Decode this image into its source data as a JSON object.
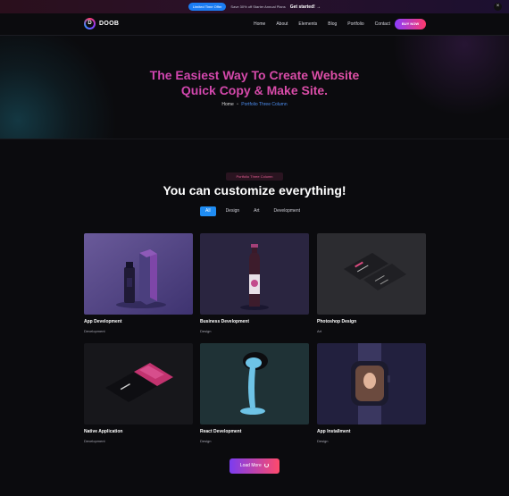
{
  "announcement": {
    "badge": "Limited Time Offer",
    "text": "Save 30% off Starter Annual Plans",
    "link": "Get started! →",
    "close": "×"
  },
  "header": {
    "logo_mark": "D",
    "logo_text": "DOOB",
    "nav": [
      "Home",
      "About",
      "Elements",
      "Blog",
      "Portfolio",
      "Contact"
    ],
    "cta": "BUY NOW"
  },
  "hero": {
    "title_line1": "The Easiest Way To Create Website",
    "title_line2": "Quick Copy & Make Site.",
    "breadcrumb": {
      "home": "Home",
      "separator": "•",
      "current": "Portfolio Three Column"
    }
  },
  "section": {
    "tag": "Portfolio Three Column",
    "title": "You can customize everything!",
    "filters": [
      "All",
      "Design",
      "Art",
      "Development"
    ],
    "active_filter": "All"
  },
  "portfolio": [
    {
      "title": "App Development",
      "category": "Development",
      "image": "purple-box-bottle-mockup"
    },
    {
      "title": "Business Development",
      "category": "Design",
      "image": "wine-bottle-mockup"
    },
    {
      "title": "Photoshop Design",
      "category": "Art",
      "image": "business-card-mockup"
    },
    {
      "title": "Native Application",
      "category": "Development",
      "image": "tilted-phone-mockup"
    },
    {
      "title": "React Development",
      "category": "Design",
      "image": "paint-can-pour-mockup"
    },
    {
      "title": "App Installment",
      "category": "Design",
      "image": "smartwatch-mockup"
    }
  ],
  "load_more": {
    "label": "Load More",
    "icon": "spinner-icon"
  },
  "colors": {
    "accent_blue": "#1f8cf2",
    "gradient_start": "#8a3cff",
    "gradient_end": "#ff3a6b",
    "hero_title": "#d84aa9"
  }
}
